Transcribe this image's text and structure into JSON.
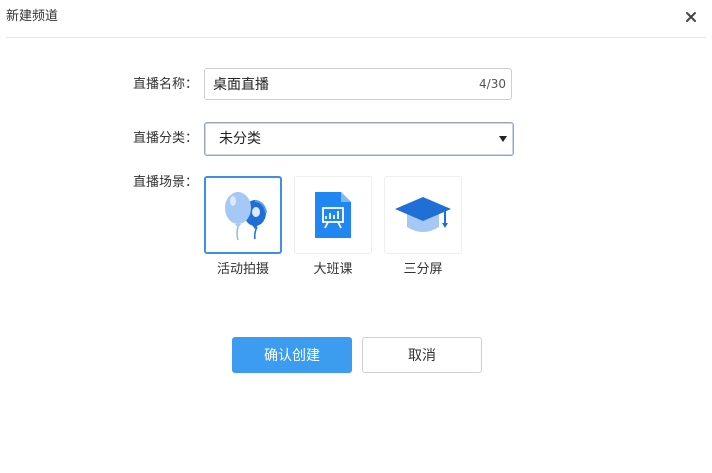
{
  "dialog": {
    "title": "新建频道",
    "close_icon": "close-icon"
  },
  "form": {
    "name_label": "直播名称：",
    "name_value": "桌面直播",
    "name_count": "4/30",
    "category_label": "直播分类：",
    "category_value": "未分类",
    "scene_label": "直播场景："
  },
  "scenes": [
    {
      "label": "活动拍摄",
      "icon": "balloon-icon",
      "selected": true
    },
    {
      "label": "大班课",
      "icon": "presentation-document-icon",
      "selected": false
    },
    {
      "label": "三分屏",
      "icon": "graduation-cap-icon",
      "selected": false
    }
  ],
  "buttons": {
    "confirm_label": "确认创建",
    "cancel_label": "取消"
  },
  "colors": {
    "primary": "#3b9cf0",
    "selected_border": "#3d8fe8",
    "icon_blue": "#1f86f2",
    "icon_light_blue": "#a6c8f5"
  }
}
